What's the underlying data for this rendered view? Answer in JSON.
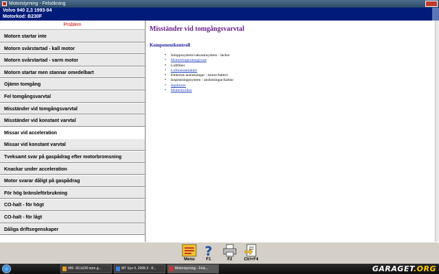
{
  "window": {
    "title": "Motorstyrning - Felsökning"
  },
  "header": {
    "vehicle": "Volvo 940 2,3 1993-94",
    "engine": "Motorkod: B230F"
  },
  "sidebar": {
    "heading": "Problem",
    "selected_index": 8,
    "items": [
      {
        "label": "Motorn startar inte"
      },
      {
        "label": "Motorn svårstartad - kall motor"
      },
      {
        "label": "Motorn svårstartad - varm motor"
      },
      {
        "label": "Motorn startar men stannar omedelbart"
      },
      {
        "label": "Ojämn tomgång"
      },
      {
        "label": "Fel tomgångsvarvtal"
      },
      {
        "label": "Misständer vid tomgångsvarvtal"
      },
      {
        "label": "Misständer vid konstant varvtal"
      },
      {
        "label": "Missar vid acceleration"
      },
      {
        "label": "Missar vid konstant varvtal"
      },
      {
        "label": "Tveksamt svar på gaspådrag efter motorbromsning"
      },
      {
        "label": "Knackar under acceleration"
      },
      {
        "label": "Motor svarar dåligt på gaspådrag"
      },
      {
        "label": "För hög bränsleförbrukning"
      },
      {
        "label": "CO-halt - för högt"
      },
      {
        "label": "CO-halt - för lågt"
      },
      {
        "label": "Dåliga driftsegenskaper"
      }
    ]
  },
  "content": {
    "title": "Misständer vid tomgångsvarvtal",
    "section": "Komponentkontroll",
    "items": [
      {
        "text": "Inloppssystem/vakuumsystem - läckor",
        "link": false
      },
      {
        "text": "Motortemperaturgivare",
        "link": true
      },
      {
        "text": "Luftfilter",
        "link": false
      },
      {
        "text": "Luftmassamätare",
        "link": true
      },
      {
        "text": "Elektrisk anslutningar - motor/batteri",
        "link": false
      },
      {
        "text": "Insprutningssystem - anslutningar/kablar",
        "link": false
      },
      {
        "text": "Injektorer",
        "link": true
      },
      {
        "text": "Motorstyrdon",
        "link": true
      }
    ]
  },
  "toolbar": {
    "buttons": [
      {
        "label": "Menu",
        "icon": "menu-icon"
      },
      {
        "label": "F1",
        "icon": "help-icon"
      },
      {
        "label": "F2",
        "icon": "print-icon"
      },
      {
        "label": "Ctrl+F4",
        "icon": "exit-icon"
      }
    ]
  },
  "taskbar": {
    "tasks": [
      {
        "label": "945 -93 b230 som g..."
      },
      {
        "label": "MT Sys II, 2008.3 - K..."
      },
      {
        "label": "Motorstyrning - Fels..."
      }
    ]
  },
  "logo": {
    "text": "GARAGET",
    "suffix": ".ORG"
  }
}
